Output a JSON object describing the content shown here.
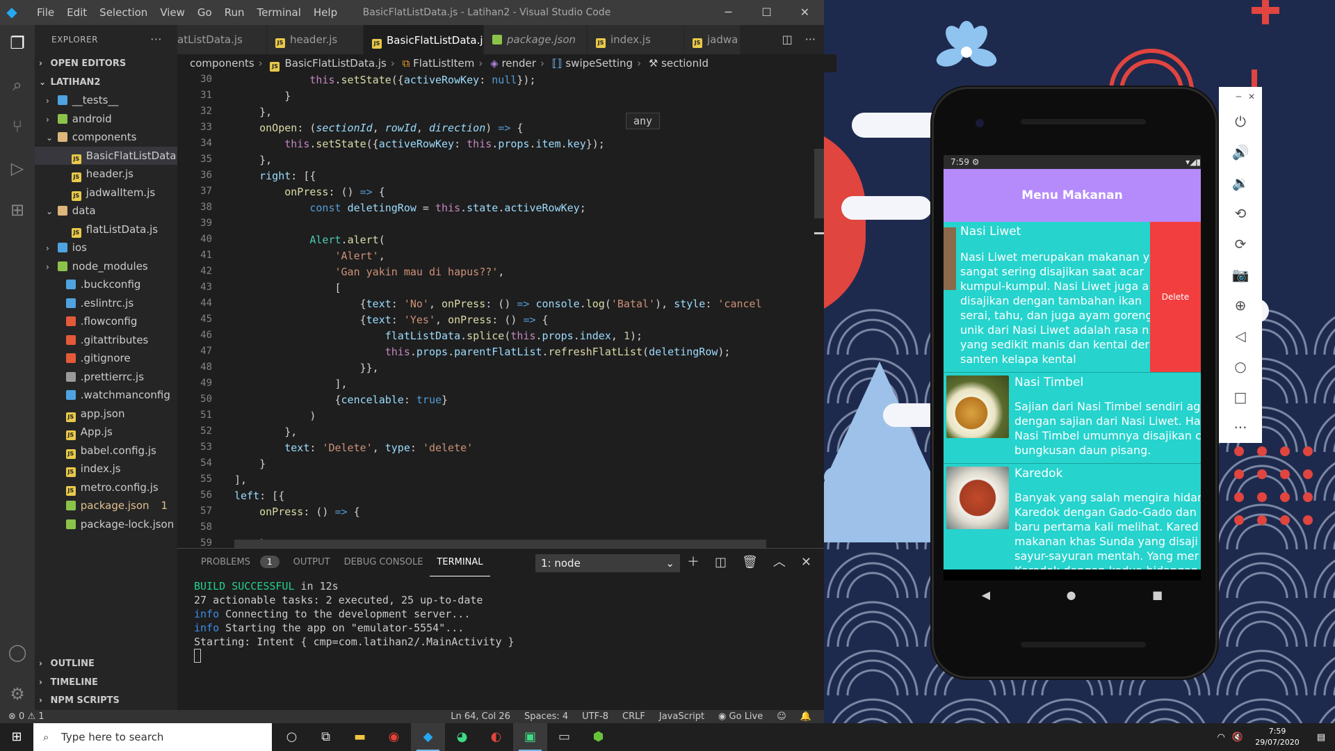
{
  "titlebar": {
    "menu": [
      "File",
      "Edit",
      "Selection",
      "View",
      "Go",
      "Run",
      "Terminal",
      "Help"
    ],
    "title": "BasicFlatListData.js - Latihan2 - Visual Studio Code"
  },
  "sidebar": {
    "header": "EXPLORER",
    "open_editors": "OPEN EDITORS",
    "project": "LATIHAN2",
    "items": [
      {
        "label": "__tests__"
      },
      {
        "label": "android"
      },
      {
        "label": "components"
      },
      {
        "label": "BasicFlatListData..."
      },
      {
        "label": "header.js"
      },
      {
        "label": "jadwalItem.js"
      },
      {
        "label": "data"
      },
      {
        "label": "flatListData.js"
      },
      {
        "label": "ios"
      },
      {
        "label": "node_modules"
      },
      {
        "label": ".buckconfig"
      },
      {
        "label": ".eslintrc.js"
      },
      {
        "label": ".flowconfig"
      },
      {
        "label": ".gitattributes"
      },
      {
        "label": ".gitignore"
      },
      {
        "label": ".prettierrc.js"
      },
      {
        "label": ".watchmanconfig"
      },
      {
        "label": "app.json"
      },
      {
        "label": "App.js"
      },
      {
        "label": "babel.config.js"
      },
      {
        "label": "index.js"
      },
      {
        "label": "metro.config.js"
      },
      {
        "label": "package.json",
        "badge": "1"
      },
      {
        "label": "package-lock.json"
      }
    ],
    "outline": "OUTLINE",
    "timeline": "TIMELINE",
    "npm": "NPM SCRIPTS"
  },
  "tabs": [
    {
      "label": "atListData.js"
    },
    {
      "label": "header.js"
    },
    {
      "label": "BasicFlatListData.js"
    },
    {
      "label": "package.json"
    },
    {
      "label": "index.js"
    },
    {
      "label": "jadwa"
    }
  ],
  "breadcrumb": [
    "components",
    "BasicFlatListData.js",
    "FlatListItem",
    "render",
    "swipeSetting",
    "sectionId"
  ],
  "editor": {
    "line_numbers": [
      "30",
      "31",
      "32",
      "33",
      "34",
      "35",
      "36",
      "37",
      "38",
      "39",
      "40",
      "41",
      "42",
      "43",
      "44",
      "45",
      "46",
      "47",
      "48",
      "49",
      "50",
      "51",
      "52",
      "53",
      "54",
      "55",
      "56",
      "57",
      "58",
      "59"
    ],
    "hover_text": "any"
  },
  "panel": {
    "tabs": [
      "PROBLEMS",
      "OUTPUT",
      "DEBUG CONSOLE",
      "TERMINAL"
    ],
    "problems_count": "1",
    "terminal_select": "1: node",
    "terminal_lines": {
      "build": "BUILD SUCCESSFUL",
      "build_rest": " in 12s",
      "l2": "27 actionable tasks: 2 executed, 25 up-to-date",
      "info": "info",
      "l3": " Connecting to the development server...",
      "l4": " Starting the app on \"emulator-5554\"...",
      "l5": "Starting: Intent { cmp=com.latihan2/.MainActivity }"
    }
  },
  "statusbar": {
    "errors": "0",
    "warnings": "1",
    "position": "Ln 64, Col 26",
    "spaces": "Spaces: 4",
    "encoding": "UTF-8",
    "eol": "CRLF",
    "language": "JavaScript",
    "golive": "Go Live"
  },
  "phone": {
    "time": "7:59",
    "appbar": "Menu Makanan",
    "delete_label": "Delete",
    "items": [
      {
        "title": "Nasi Liwet",
        "desc": [
          "Nasi Liwet merupakan makanan y",
          "sangat sering disajikan saat acar",
          "kumpul-kumpul. Nasi Liwet juga a",
          "disajikan dengan tambahan ikan",
          "serai, tahu, dan juga ayam goreng",
          "unik dari Nasi Liwet adalah rasa n",
          "yang sedikit manis dan kental der",
          "santen kelapa kental"
        ]
      },
      {
        "title": "Nasi Timbel",
        "desc": [
          "Sajian dari Nasi Timbel sendiri ag",
          "dengan sajian dari Nasi Liwet. Ha",
          "Nasi Timbel umumnya disajikan c",
          "bungkusan daun pisang."
        ]
      },
      {
        "title": "Karedok",
        "desc": [
          "Banyak yang salah mengira hidan",
          "Karedok dengan Gado-Gado dan",
          "baru pertama kali melihat. Kared",
          "makanan khas Sunda yang disaji",
          "sayur-sayuran mentah. Yang mer",
          "Karedok dengan kedua hidangan"
        ]
      }
    ]
  },
  "taskbar": {
    "search_placeholder": "Type here to search",
    "time": "7:59",
    "date": "29/07/2020"
  }
}
